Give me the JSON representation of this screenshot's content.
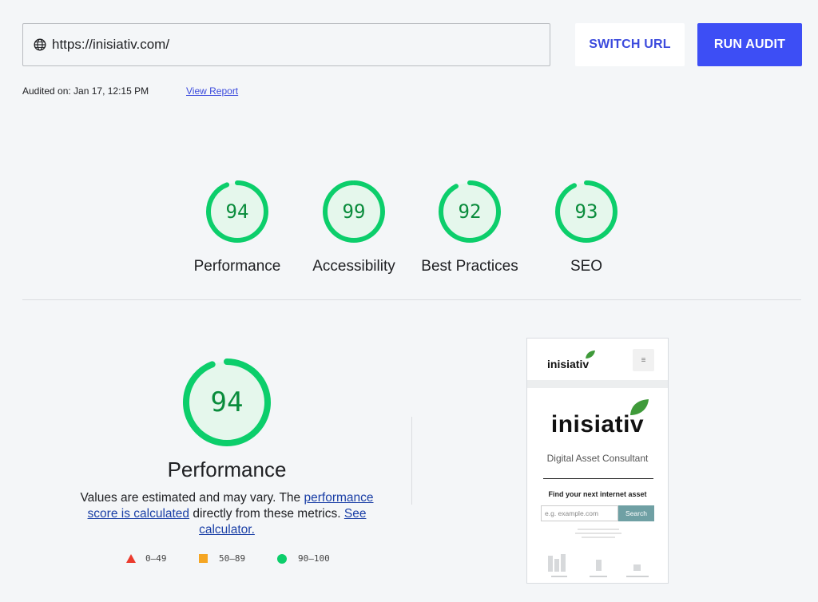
{
  "topbar": {
    "url": "https://inisiativ.com/",
    "switch_url_label": "SWITCH URL",
    "run_audit_label": "RUN AUDIT",
    "audited_on": "Audited on: Jan 17, 12:15 PM",
    "view_report": "View Report"
  },
  "scores": [
    {
      "label": "Performance",
      "value": 94
    },
    {
      "label": "Accessibility",
      "value": 99
    },
    {
      "label": "Best Practices",
      "value": 92
    },
    {
      "label": "SEO",
      "value": 93
    }
  ],
  "performance": {
    "score": 94,
    "title": "Performance",
    "desc_prefix": "Values are estimated and may vary. The ",
    "desc_link1": "performance score is calculated",
    "desc_mid": " directly from these metrics. ",
    "desc_link2": "See calculator."
  },
  "legend": {
    "fail": "0–49",
    "average": "50–89",
    "pass": "90–100"
  },
  "thumbnail": {
    "logo_small": "inisiativ",
    "logo_big": "inisiativ",
    "tagline": "Digital Asset Consultant",
    "find_text": "Find your next internet asset",
    "input_placeholder": "e.g. example.com",
    "search_label": "Search",
    "menu_icon": "≡"
  },
  "colors": {
    "pass": "#0cce6b",
    "average": "#f5a623",
    "fail": "#eb3b2e",
    "accent": "#3d4ef5"
  }
}
